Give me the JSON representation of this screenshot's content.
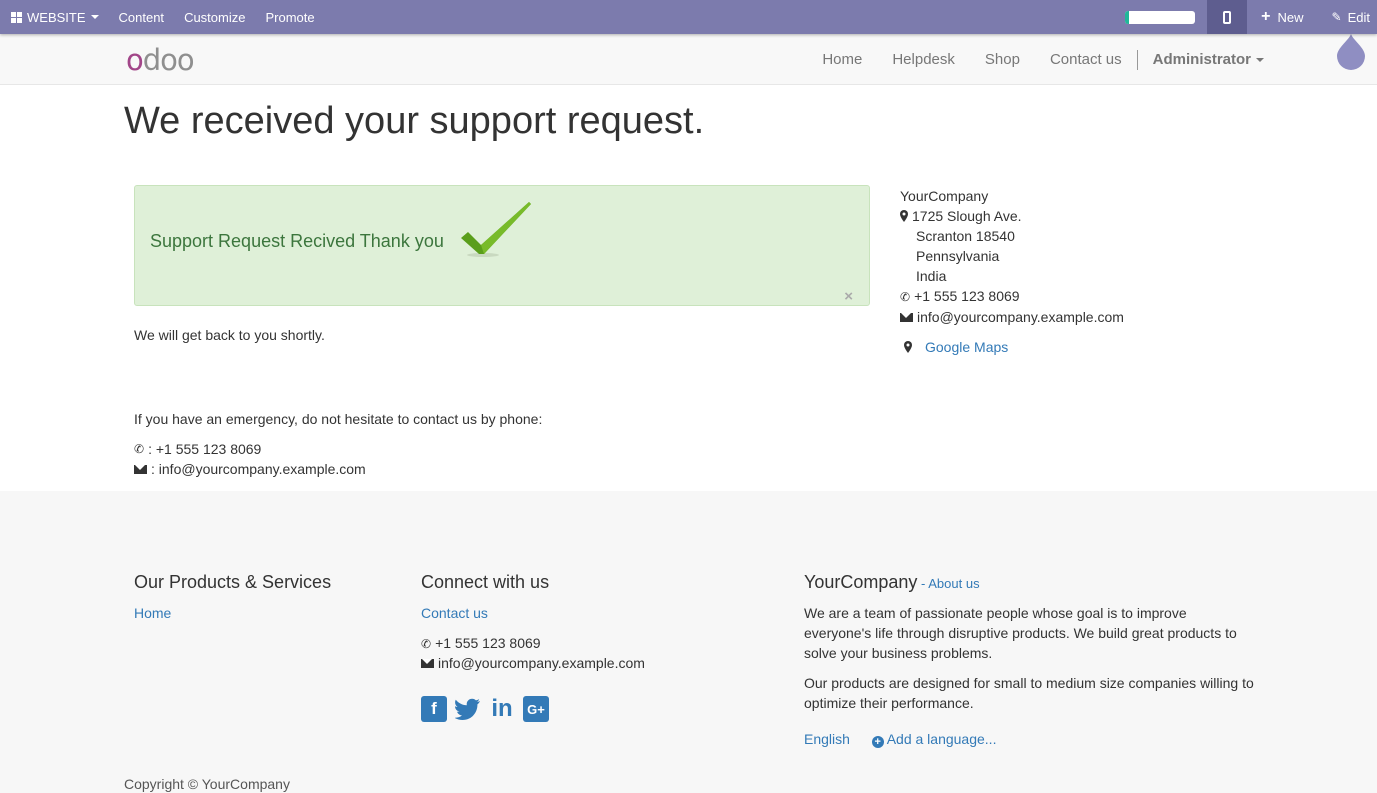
{
  "adminbar": {
    "website_label": "WEBSITE",
    "content_label": "Content",
    "customize_label": "Customize",
    "promote_label": "Promote",
    "progress_percent": 5,
    "new_label": "New",
    "edit_label": "Edit"
  },
  "header": {
    "logo_text": "odoo",
    "nav": [
      "Home",
      "Helpdesk",
      "Shop",
      "Contact us"
    ],
    "user": "Administrator"
  },
  "main": {
    "title": "We received your support request.",
    "alert_text": "Support Request Recived Thank you",
    "close_glyph": "×",
    "reply_note": "We will get back to you shortly.",
    "emergency_note": "If you have an emergency, do not hesitate to contact us by phone:",
    "phone_line": ": +1 555 123 8069",
    "email_line": ": info@yourcompany.example.com"
  },
  "company_card": {
    "name": "YourCompany",
    "street": "1725 Slough Ave.",
    "city": "Scranton 18540",
    "state": "Pennsylvania",
    "country": "India",
    "phone": "+1 555 123 8069",
    "email": "info@yourcompany.example.com",
    "maps_label": "Google Maps"
  },
  "footer": {
    "products_title": "Our Products & Services",
    "products_links": [
      "Home"
    ],
    "connect_title": "Connect with us",
    "connect_link": "Contact us",
    "phone": "+1 555 123 8069",
    "email": "info@yourcompany.example.com",
    "social": [
      "facebook-icon",
      "twitter-icon",
      "linkedin-icon",
      "google-plus-icon"
    ],
    "company_title": "YourCompany",
    "about_link": "About us",
    "about_sep": " - ",
    "about_p1": "We are a team of passionate people whose goal is to improve everyone's life through disruptive products. We build great products to solve your business problems.",
    "about_p2": "Our products are designed for small to medium size companies willing to optimize their performance.",
    "lang_current": "English",
    "lang_add": "Add a language...",
    "copyright": "Copyright © YourCompany"
  },
  "colors": {
    "adminbar": "#7c7bad",
    "alert_bg": "#dff0d8",
    "alert_text": "#3c763d",
    "link": "#337ab7",
    "check": "#5a9e1b"
  }
}
